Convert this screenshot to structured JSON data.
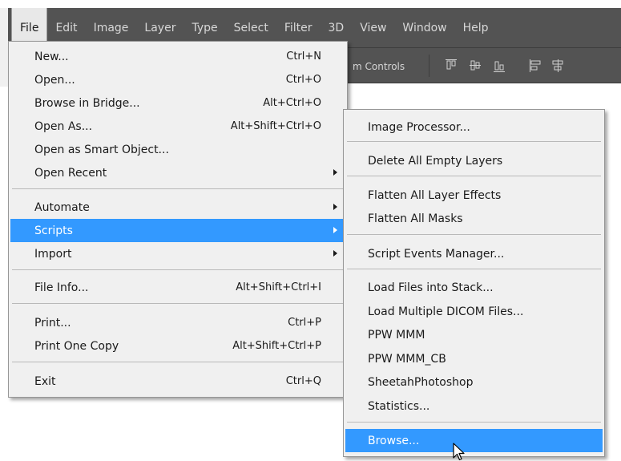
{
  "menubar": {
    "items": [
      "File",
      "Edit",
      "Image",
      "Layer",
      "Type",
      "Select",
      "Filter",
      "3D",
      "View",
      "Window",
      "Help"
    ],
    "active_index": 0
  },
  "options_bar": {
    "transform_controls_label": "m Controls"
  },
  "file_menu": {
    "items": [
      {
        "label": "New...",
        "shortcut": "Ctrl+N"
      },
      {
        "label": "Open...",
        "shortcut": "Ctrl+O"
      },
      {
        "label": "Browse in Bridge...",
        "shortcut": "Alt+Ctrl+O"
      },
      {
        "label": "Open As...",
        "shortcut": "Alt+Shift+Ctrl+O"
      },
      {
        "label": "Open as Smart Object...",
        "shortcut": ""
      },
      {
        "label": "Open Recent",
        "shortcut": ""
      },
      {
        "label": "Automate",
        "shortcut": ""
      },
      {
        "label": "Scripts",
        "shortcut": ""
      },
      {
        "label": "Import",
        "shortcut": ""
      },
      {
        "label": "File Info...",
        "shortcut": "Alt+Shift+Ctrl+I"
      },
      {
        "label": "Print...",
        "shortcut": "Ctrl+P"
      },
      {
        "label": "Print One Copy",
        "shortcut": "Alt+Shift+Ctrl+P"
      },
      {
        "label": "Exit",
        "shortcut": "Ctrl+Q"
      }
    ],
    "highlighted": "Scripts"
  },
  "scripts_menu": {
    "items": [
      "Image Processor...",
      "Delete All Empty Layers",
      "Flatten All Layer Effects",
      "Flatten All Masks",
      "Script Events Manager...",
      "Load Files into Stack...",
      "Load Multiple DICOM Files...",
      "PPW MMM",
      "PPW MMM_CB",
      "SheetahPhotoshop",
      "Statistics...",
      "Browse..."
    ],
    "highlighted": "Browse..."
  },
  "colors": {
    "menubar_bg": "#535353",
    "menu_bg": "#f0f0f0",
    "highlight": "#3399ff"
  }
}
